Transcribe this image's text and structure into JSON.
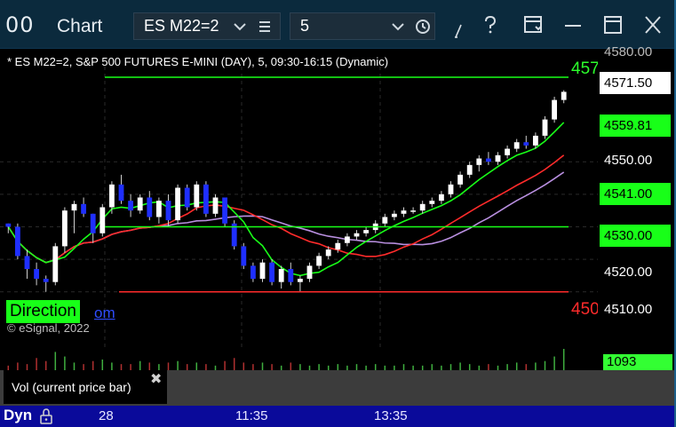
{
  "window": {
    "app_icon": "00",
    "title": "Chart",
    "symbol": "ES M22=2",
    "interval": "5",
    "icons": [
      "chevron-down-icon",
      "menu-icon",
      "clock-icon",
      "draw-icon",
      "help-icon",
      "layout-icon",
      "minimize-icon",
      "maximize-icon",
      "close-icon"
    ]
  },
  "chart": {
    "header": "* ES M22=2, S&P 500 FUTURES E-MINI (DAY), 5, 09:30-16:15 (Dynamic)",
    "copyright": "© eSignal, 2022",
    "direction_label": "Direction",
    "direction_suffix": "om",
    "green_line_label": "457",
    "red_line_label": "450"
  },
  "price_axis": {
    "ticks": [
      "4580.00",
      "4550.00",
      "4520.00",
      "4510.00"
    ],
    "last_price": "4571.50",
    "level_1": "4559.81",
    "level_2": "4541.00",
    "level_3": "4530.00"
  },
  "volume": {
    "value": "1093",
    "study_label": "Vol (current price bar)",
    "close_glyph": "✖"
  },
  "time_axis": {
    "dyn_label": "Dyn",
    "labels": [
      "28",
      "11:35",
      "13:35"
    ]
  },
  "colors": {
    "title_bar": "#0b2a3d",
    "up_candle": "#ffffff",
    "down_candle": "#1f2fff",
    "green": "#18ff18",
    "red": "#ff2b2b",
    "purple": "#b98fe0",
    "time_axis": "#0a0a9a"
  },
  "chart_data": {
    "type": "candlestick",
    "y_range": [
      4505,
      4582
    ],
    "reference_lines": [
      {
        "value": 4576,
        "color": "green"
      },
      {
        "value": 4510,
        "color": "red"
      },
      {
        "value": 4530,
        "color": "green"
      }
    ],
    "candles": [
      [
        4531,
        4531,
        4528,
        4530
      ],
      [
        4530,
        4531,
        4520,
        4521
      ],
      [
        4521,
        4523,
        4514,
        4517
      ],
      [
        4517,
        4519,
        4512,
        4514
      ],
      [
        4514,
        4515,
        4510,
        4513
      ],
      [
        4513,
        4525,
        4512,
        4524
      ],
      [
        4524,
        4536,
        4522,
        4535
      ],
      [
        4535,
        4538,
        4528,
        4537
      ],
      [
        4537,
        4539,
        4533,
        4534
      ],
      [
        4534,
        4534,
        4525,
        4528
      ],
      [
        4528,
        4537,
        4527,
        4536
      ],
      [
        4536,
        4544,
        4534,
        4543
      ],
      [
        4543,
        4546,
        4537,
        4538
      ],
      [
        4538,
        4540,
        4533,
        4535
      ],
      [
        4535,
        4540,
        4534,
        4539
      ],
      [
        4539,
        4541,
        4532,
        4533
      ],
      [
        4533,
        4539,
        4531,
        4538
      ],
      [
        4538,
        4540,
        4530,
        4532
      ],
      [
        4532,
        4543,
        4531,
        4542
      ],
      [
        4542,
        4543,
        4535,
        4536
      ],
      [
        4536,
        4544,
        4535,
        4543
      ],
      [
        4543,
        4544,
        4533,
        4534
      ],
      [
        4534,
        4540,
        4533,
        4539
      ],
      [
        4539,
        4539,
        4530,
        4531
      ],
      [
        4531,
        4532,
        4523,
        4524
      ],
      [
        4524,
        4525,
        4517,
        4518
      ],
      [
        4518,
        4519,
        4513,
        4514
      ],
      [
        4514,
        4520,
        4513,
        4519
      ],
      [
        4519,
        4520,
        4512,
        4513
      ],
      [
        4513,
        4518,
        4511,
        4517
      ],
      [
        4517,
        4519,
        4512,
        4513
      ],
      [
        4513,
        4515,
        4510,
        4514
      ],
      [
        4514,
        4519,
        4513,
        4518
      ],
      [
        4518,
        4522,
        4517,
        4521
      ],
      [
        4521,
        4524,
        4520,
        4523
      ],
      [
        4523,
        4526,
        4522,
        4525
      ],
      [
        4525,
        4528,
        4524,
        4527
      ],
      [
        4527,
        4529,
        4526,
        4528
      ],
      [
        4528,
        4530,
        4527,
        4529
      ],
      [
        4529,
        4532,
        4528,
        4531
      ],
      [
        4531,
        4534,
        4530,
        4533
      ],
      [
        4533,
        4535,
        4532,
        4534
      ],
      [
        4534,
        4536,
        4533,
        4535
      ],
      [
        4535,
        4536,
        4534,
        4535
      ],
      [
        4535,
        4538,
        4534,
        4537
      ],
      [
        4537,
        4539,
        4536,
        4538
      ],
      [
        4538,
        4541,
        4537,
        4540
      ],
      [
        4540,
        4544,
        4539,
        4543
      ],
      [
        4543,
        4547,
        4542,
        4546
      ],
      [
        4546,
        4550,
        4545,
        4549
      ],
      [
        4549,
        4552,
        4547,
        4551
      ],
      [
        4551,
        4553,
        4549,
        4550
      ],
      [
        4550,
        4553,
        4549,
        4552
      ],
      [
        4552,
        4555,
        4551,
        4554
      ],
      [
        4554,
        4557,
        4553,
        4556
      ],
      [
        4556,
        4558,
        4554,
        4555
      ],
      [
        4555,
        4559,
        4554,
        4558
      ],
      [
        4558,
        4564,
        4557,
        4563
      ],
      [
        4563,
        4570,
        4562,
        4569
      ],
      [
        4569,
        4572,
        4568,
        4571.5
      ]
    ],
    "volume": [
      3,
      5,
      4,
      8,
      6,
      12,
      9,
      5,
      4,
      6,
      7,
      5,
      4,
      4,
      6,
      5,
      4,
      5,
      6,
      4,
      5,
      4,
      3,
      6,
      8,
      5,
      4,
      5,
      4,
      3,
      5,
      4,
      3,
      4,
      3,
      4,
      3,
      4,
      3,
      4,
      3,
      3,
      4,
      3,
      3,
      4,
      3,
      4,
      5,
      4,
      3,
      4,
      3,
      4,
      5,
      4,
      5,
      6,
      9,
      14
    ]
  }
}
